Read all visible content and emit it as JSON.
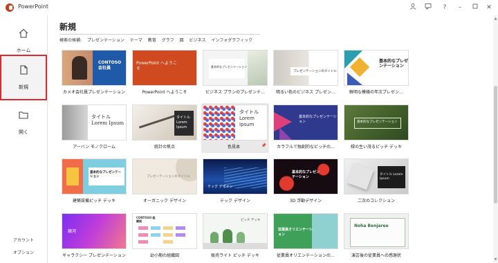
{
  "app": {
    "title": "PowerPoint"
  },
  "titlebar": {
    "icons": [
      "avatar-icon",
      "feedback-icon",
      "help-icon",
      "minimize-icon",
      "maximize-icon",
      "close-icon"
    ]
  },
  "sidebar": {
    "items": [
      {
        "label": "ホーム",
        "icon": "home-icon"
      },
      {
        "label": "新規",
        "icon": "new-document-icon"
      },
      {
        "label": "開く",
        "icon": "folder-icon"
      }
    ],
    "bottom": [
      "アカウント",
      "オプション"
    ]
  },
  "main": {
    "title": "新規",
    "suggest_label": "検索の候補:",
    "suggestions": [
      "プレゼンテーション",
      "テーマ",
      "教育",
      "グラフ",
      "図",
      "ビジネス",
      "インフォグラフィック"
    ]
  },
  "templates": [
    {
      "caption": "カメオ会社員プレゼンテーション",
      "thumb_title": "CONTOSO 会社員"
    },
    {
      "caption": "PowerPoint へようこそ",
      "thumb_title": "PowerPoint へようこそ"
    },
    {
      "caption": "ビジネス プランのプレゼンテ…",
      "thumb_title": "基本的なプレゼンテーション"
    },
    {
      "caption": "明るい色のビジネス プレゼン…",
      "thumb_title": "プレゼンテーションのタイトル"
    },
    {
      "caption": "鮮明な模様の年次プレゼン…",
      "thumb_title": "基本的なプレゼンテーション"
    },
    {
      "caption": "アーバン モノクローム",
      "thumb_title": "タイトル Lorem Ipsum"
    },
    {
      "caption": "統計の焦点",
      "thumb_title": "タイトル Lorem Ipsum"
    },
    {
      "caption": "色見本",
      "thumb_title": "タイトル Lorem Ipsum"
    },
    {
      "caption": "カラフルで独創的なピッチの…",
      "thumb_title": "基本的なプレゼンテーション"
    },
    {
      "caption": "緑の生い茂るピッチ デッキ",
      "thumb_title": "基本的なプレゼンテーション"
    },
    {
      "caption": "建築設備ピッチ デッキ",
      "thumb_title": "基本的なプレゼンテーション"
    },
    {
      "caption": "オーガニック デザイン",
      "thumb_title": "プレゼンテーションのタイトル"
    },
    {
      "caption": "テック デザイン",
      "thumb_title": "テック デザイン"
    },
    {
      "caption": "3D 浮動デザイン",
      "thumb_title": "基本的なプレゼンテーション"
    },
    {
      "caption": "二次のコレクション",
      "thumb_title": "タイトル Lorem Ipsum"
    },
    {
      "caption": "ギャラクシー プレゼンテーション",
      "thumb_title": "銀河"
    },
    {
      "caption": "幼小期の組織図",
      "thumb_title": "CONTOSO 組織図"
    },
    {
      "caption": "販売ライト ピッチ デッキ",
      "thumb_title": "ピッチ デッキ"
    },
    {
      "caption": "従業員オリエンテーションの…",
      "thumb_title": "従業員オリエンテーション"
    },
    {
      "caption": "演芸後の従業員への感謝状",
      "thumb_title": "Noha Benjaree"
    }
  ]
}
